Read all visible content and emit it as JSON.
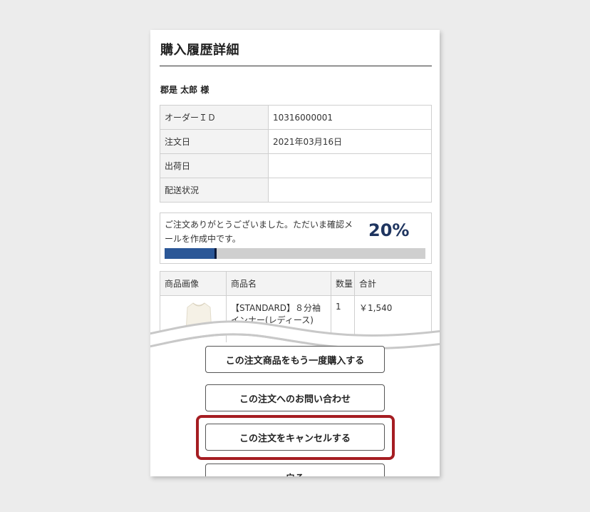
{
  "page": {
    "title": "購入履歴詳細",
    "customer_name": "郡是 太郎 様"
  },
  "order_info": [
    {
      "label": "オーダーＩＤ",
      "value": "10316000001"
    },
    {
      "label": "注文日",
      "value": "2021年03月16日"
    },
    {
      "label": "出荷日",
      "value": ""
    },
    {
      "label": "配送状況",
      "value": ""
    }
  ],
  "status": {
    "message": "ご注文ありがとうございました。ただいま確認メールを作成中です。",
    "percent_label": "20%",
    "progress": 0.2,
    "colors": {
      "fill": "#2b5797",
      "track": "#cfcfcf",
      "percent_text": "#1f3560"
    }
  },
  "items_table": {
    "headers": [
      "商品画像",
      "商品名",
      "数量",
      "合計"
    ],
    "rows": [
      {
        "image_icon": "garment-thumbnail",
        "name": "【STANDARD】８分袖インナー(レディース)",
        "qty": "1",
        "total": "￥1,540"
      }
    ]
  },
  "buttons": {
    "rebuy": "この注文商品をもう一度購入する",
    "inquiry": "この注文へのお問い合わせ",
    "cancel": "この注文をキャンセルする",
    "back": "戻る"
  },
  "highlight_color": "#a51d22"
}
